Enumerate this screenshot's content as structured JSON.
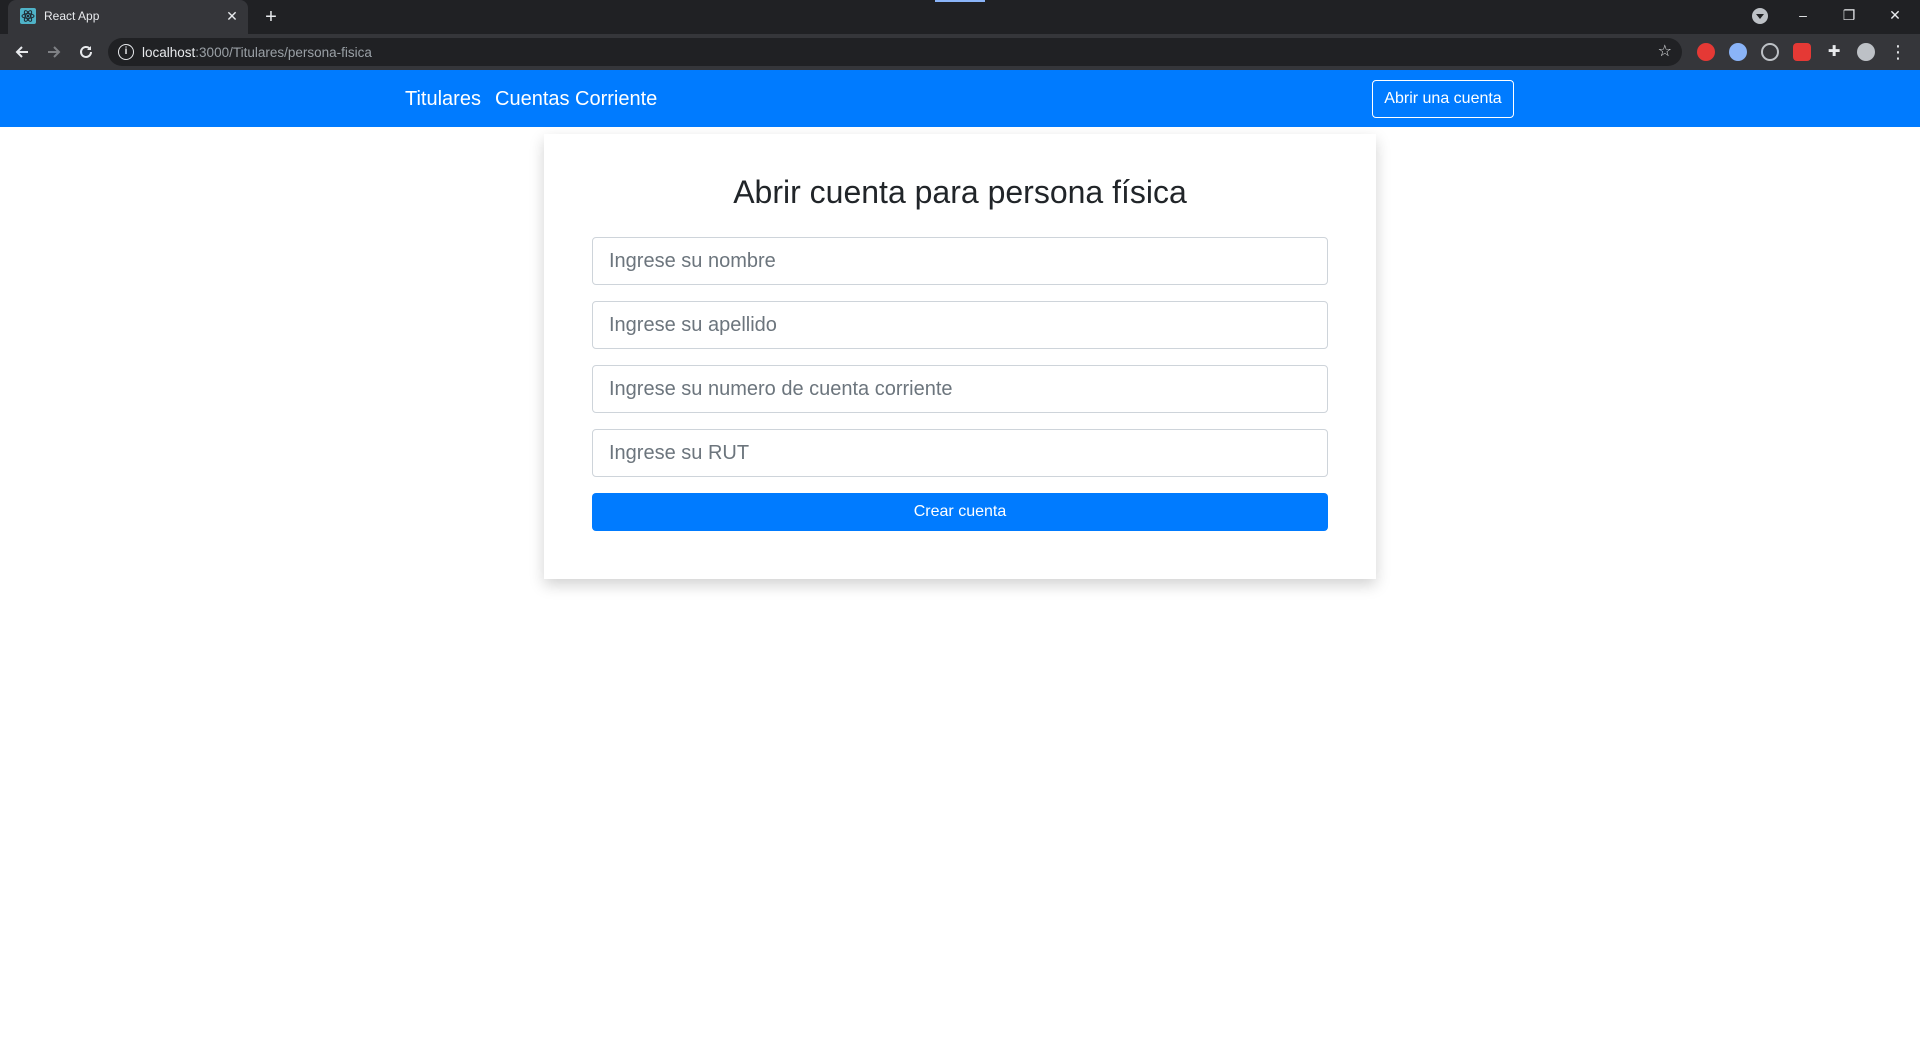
{
  "browser": {
    "tab_title": "React App",
    "tab_close_glyph": "✕",
    "new_tab_glyph": "+",
    "url_host": "localhost",
    "url_rest": ":3000/Titulares/persona-fisica",
    "window_controls": {
      "minimize": "–",
      "restore": "❐",
      "close": "✕"
    },
    "extensions": [
      {
        "name": "adblock-icon",
        "color": "#e53935"
      },
      {
        "name": "extension-blue-icon",
        "color": "#8ab4f8"
      },
      {
        "name": "extension-target-icon",
        "color": "#bdc1c6"
      },
      {
        "name": "extension-red-calendar-icon",
        "color": "#e53935"
      },
      {
        "name": "puzzle-icon",
        "color": "#e8eaed"
      },
      {
        "name": "profile-avatar-icon",
        "color": "#bdc1c6"
      }
    ]
  },
  "navbar": {
    "links": [
      "Titulares",
      "Cuentas Corriente"
    ],
    "open_account_button": "Abrir una cuenta",
    "background_color": "#007bff"
  },
  "form": {
    "title": "Abrir cuenta para persona física",
    "fields": [
      {
        "placeholder": "Ingrese su nombre",
        "value": ""
      },
      {
        "placeholder": "Ingrese su apellido",
        "value": ""
      },
      {
        "placeholder": "Ingrese su numero de cuenta corriente",
        "value": ""
      },
      {
        "placeholder": "Ingrese su RUT",
        "value": ""
      }
    ],
    "submit_label": "Crear cuenta"
  }
}
